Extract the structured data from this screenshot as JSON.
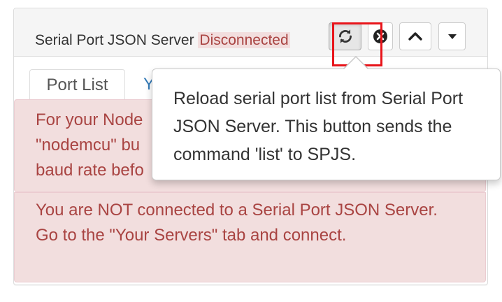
{
  "header": {
    "title": "Serial Port JSON Server",
    "status": "Disconnected",
    "buttons": {
      "refresh_icon": "refresh-icon",
      "close_icon": "close-circle-icon",
      "up_icon": "chevron-up-icon",
      "dropdown_icon": "caret-down-icon"
    }
  },
  "tabs": [
    {
      "label": "Port List"
    },
    {
      "label": "Yo"
    }
  ],
  "alerts": [
    {
      "text": "For your Node\n\"nodemcu\" bu\nbaud rate befo"
    },
    {
      "text": "You are NOT connected to a Serial Port JSON Server. Go to the \"Your Servers\" tab and connect."
    }
  ],
  "tooltip": {
    "text": "Reload serial port list from Serial Port JSON Server. This button sends the command 'list' to SPJS."
  },
  "colors": {
    "alert_bg": "#f2dede",
    "alert_text": "#a94442",
    "highlight_box": "#e8141a",
    "link": "#337ab7"
  }
}
